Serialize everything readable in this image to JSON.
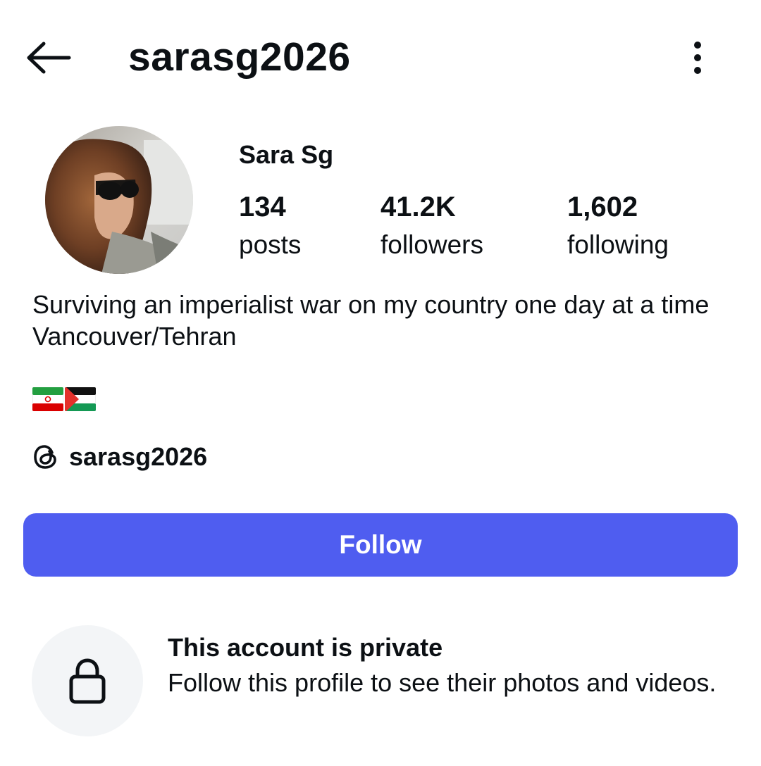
{
  "header": {
    "username": "sarasg2026",
    "back_icon": "arrow-left-icon",
    "more_icon": "vertical-dots-icon"
  },
  "profile": {
    "display_name": "Sara Sg",
    "avatar": "profile-photo"
  },
  "stats": {
    "posts": {
      "count": "134",
      "label": "posts"
    },
    "followers": {
      "count": "41.2K",
      "label": "followers"
    },
    "following": {
      "count": "1,602",
      "label": "following"
    }
  },
  "bio": {
    "line1": "Surviving an imperialist war on my country one day at a time",
    "line2": "Vancouver/Tehran",
    "flags": [
      "iran-flag",
      "palestine-flag"
    ]
  },
  "threads": {
    "icon": "threads-icon",
    "handle": "sarasg2026"
  },
  "follow_button": {
    "label": "Follow",
    "color": "#4f5df0"
  },
  "private_notice": {
    "icon": "lock-icon",
    "title": "This account is private",
    "description": "Follow this profile to see their photos and videos."
  }
}
